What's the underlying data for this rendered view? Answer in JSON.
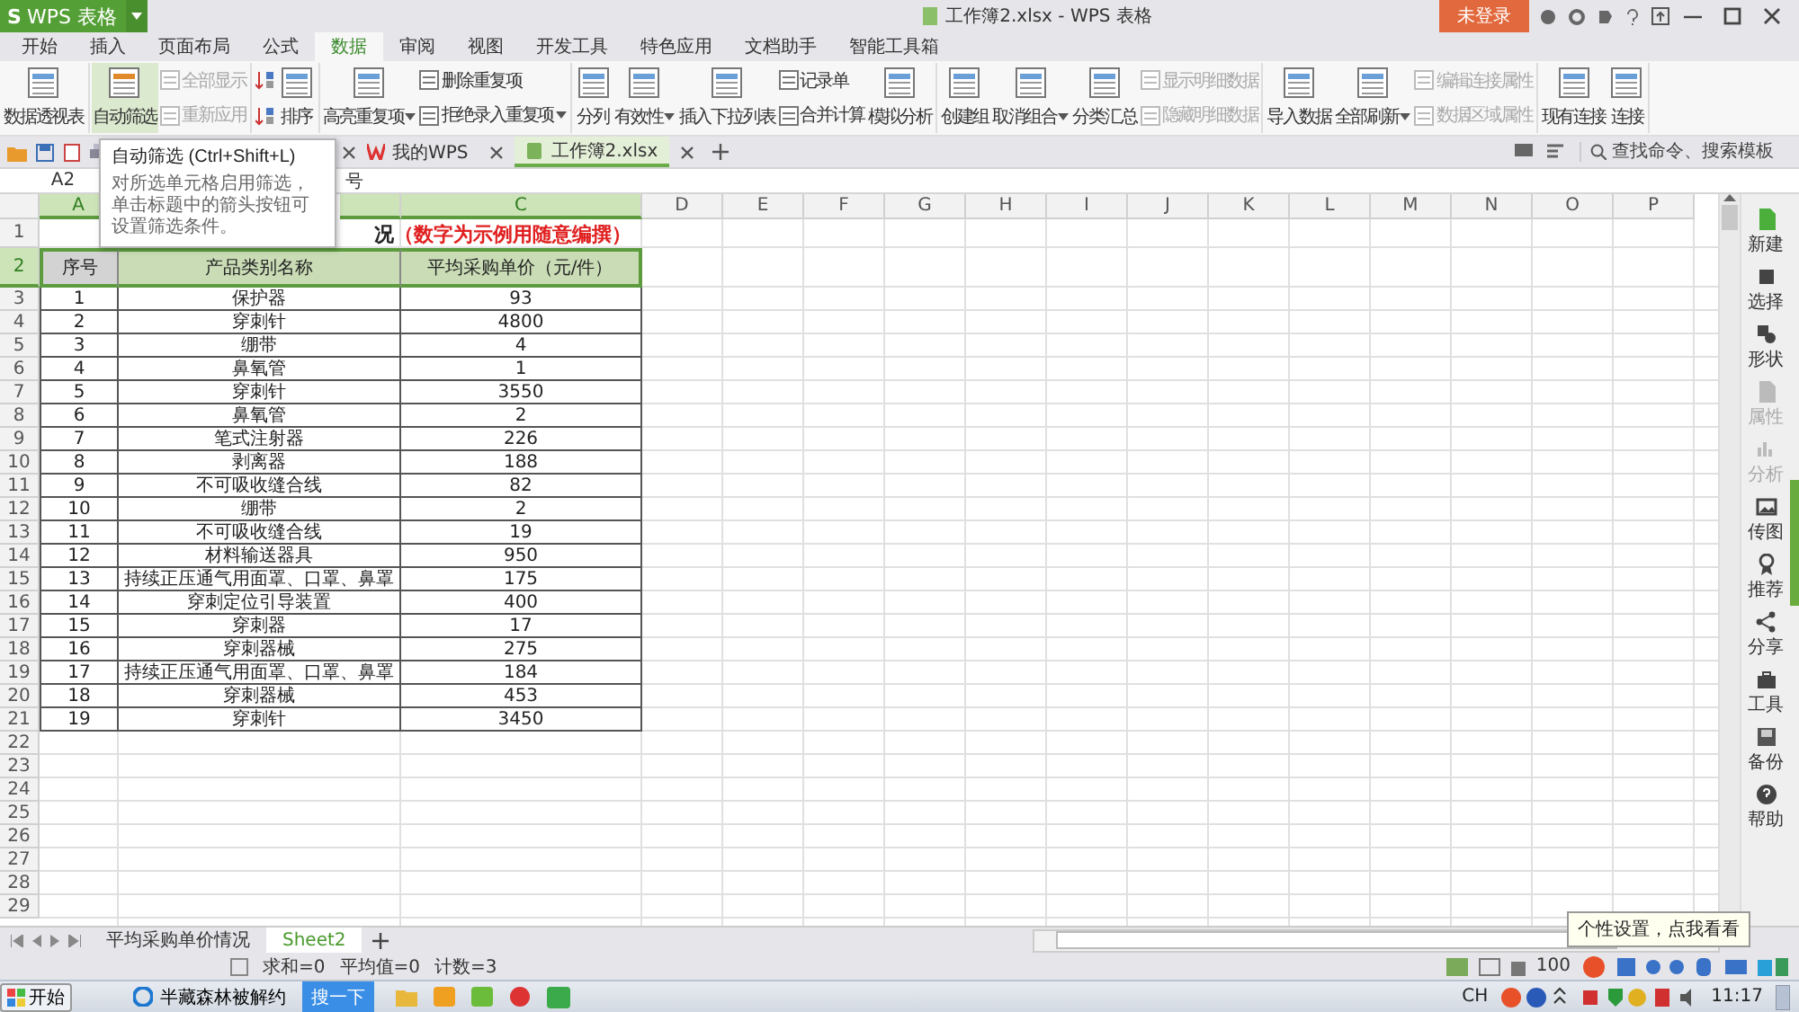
{
  "app_button": {
    "logo": "S",
    "label": "WPS 表格"
  },
  "window": {
    "title": "工作簿2.xlsx - WPS 表格"
  },
  "login_button": "未登录",
  "menu_tabs": [
    {
      "label": "开始",
      "selected": false
    },
    {
      "label": "插入",
      "selected": false
    },
    {
      "label": "页面布局",
      "selected": false
    },
    {
      "label": "公式",
      "selected": false
    },
    {
      "label": "数据",
      "selected": true
    },
    {
      "label": "审阅",
      "selected": false
    },
    {
      "label": "视图",
      "selected": false
    },
    {
      "label": "开发工具",
      "selected": false
    },
    {
      "label": "特色应用",
      "selected": false
    },
    {
      "label": "文档助手",
      "selected": false
    },
    {
      "label": "智能工具箱",
      "selected": false
    }
  ],
  "ribbon": [
    {
      "items": [
        {
          "kind": "large",
          "label": "数据透视表",
          "dropdown": false,
          "disabled": false,
          "hovered": false
        }
      ]
    },
    {
      "items": [
        {
          "kind": "large",
          "label": "自动筛选",
          "dropdown": false,
          "disabled": false,
          "hovered": true
        },
        {
          "kind": "small",
          "label": "全部显示",
          "dropdown": false,
          "disabled": true,
          "hovered": false
        },
        {
          "kind": "small",
          "label": "重新应用",
          "dropdown": false,
          "disabled": true,
          "hovered": false
        }
      ]
    },
    {
      "items": [
        {
          "kind": "icon"
        },
        {
          "kind": "icon"
        },
        {
          "kind": "large",
          "label": "排序",
          "dropdown": false,
          "disabled": false,
          "hovered": false
        }
      ]
    },
    {
      "items": [
        {
          "kind": "large",
          "label": "高亮重复项",
          "dropdown": true,
          "disabled": false,
          "hovered": false
        },
        {
          "kind": "small",
          "label": "删除重复项",
          "dropdown": false,
          "disabled": false,
          "hovered": false
        },
        {
          "kind": "small",
          "label": "拒绝录入重复项",
          "dropdown": true,
          "disabled": false,
          "hovered": false
        }
      ]
    },
    {
      "items": [
        {
          "kind": "large",
          "label": "分列",
          "dropdown": false,
          "disabled": false,
          "hovered": false
        },
        {
          "kind": "large",
          "label": "有效性",
          "dropdown": true,
          "disabled": false,
          "hovered": false
        },
        {
          "kind": "large",
          "label": "插入下拉列表",
          "dropdown": false,
          "disabled": false,
          "hovered": false
        },
        {
          "kind": "small",
          "label": "记录单",
          "dropdown": false,
          "disabled": false,
          "hovered": false
        },
        {
          "kind": "small",
          "label": "合并计算",
          "dropdown": false,
          "disabled": false,
          "hovered": false
        },
        {
          "kind": "large",
          "label": "模拟分析",
          "dropdown": false,
          "disabled": false,
          "hovered": false
        }
      ]
    },
    {
      "items": [
        {
          "kind": "large",
          "label": "创建组",
          "dropdown": false,
          "disabled": false,
          "hovered": false
        },
        {
          "kind": "large",
          "label": "取消组合",
          "dropdown": true,
          "disabled": false,
          "hovered": false
        },
        {
          "kind": "large",
          "label": "分类汇总",
          "dropdown": false,
          "disabled": false,
          "hovered": false
        },
        {
          "kind": "small",
          "label": "显示明细数据",
          "dropdown": false,
          "disabled": true,
          "hovered": false
        },
        {
          "kind": "small",
          "label": "隐藏明细数据",
          "dropdown": false,
          "disabled": true,
          "hovered": false
        }
      ]
    },
    {
      "items": [
        {
          "kind": "large",
          "label": "导入数据",
          "dropdown": false,
          "disabled": false,
          "hovered": false
        },
        {
          "kind": "large",
          "label": "全部刷新",
          "dropdown": true,
          "disabled": false,
          "hovered": false
        },
        {
          "kind": "small",
          "label": "编辑连接属性",
          "dropdown": false,
          "disabled": true,
          "hovered": false
        },
        {
          "kind": "small",
          "label": "数据区域属性",
          "dropdown": false,
          "disabled": true,
          "hovered": false
        }
      ]
    },
    {
      "items": [
        {
          "kind": "large",
          "label": "现有连接",
          "dropdown": false,
          "disabled": false,
          "hovered": false
        },
        {
          "kind": "large",
          "label": "连接",
          "dropdown": false,
          "disabled": false,
          "hovered": false
        }
      ]
    }
  ],
  "doc_tabs": [
    {
      "label": "我的WPS",
      "selected": false
    },
    {
      "label": "工作簿2.xlsx",
      "selected": true
    }
  ],
  "search": {
    "placeholder": "查找命令、搜索模板"
  },
  "formula_bar": {
    "cell": "A2",
    "content": "号"
  },
  "sheet": {
    "columns": [
      {
        "label": "A",
        "selected": true
      },
      {
        "selected": true
      },
      {
        "label": "C",
        "selected": true
      },
      {
        "label": "D",
        "selected": false
      },
      {
        "label": "E",
        "selected": false
      },
      {
        "label": "F",
        "selected": false
      },
      {
        "label": "G",
        "selected": false
      },
      {
        "label": "H",
        "selected": false
      },
      {
        "label": "I",
        "selected": false
      },
      {
        "label": "J",
        "selected": false
      },
      {
        "label": "K",
        "selected": false
      },
      {
        "label": "L",
        "selected": false
      },
      {
        "label": "M",
        "selected": false
      },
      {
        "label": "N",
        "selected": false
      },
      {
        "label": "O",
        "selected": false
      },
      {
        "label": "P",
        "selected": false
      }
    ],
    "row_numbers": [
      {
        "label": "1",
        "selected": false
      },
      {
        "label": "2",
        "selected": true
      },
      {
        "label": "3",
        "selected": false
      },
      {
        "label": "4",
        "selected": false
      },
      {
        "label": "5",
        "selected": false
      },
      {
        "label": "6",
        "selected": false
      },
      {
        "label": "7",
        "selected": false
      },
      {
        "label": "8",
        "selected": false
      },
      {
        "label": "9",
        "selected": false
      },
      {
        "label": "10",
        "selected": false
      },
      {
        "label": "11",
        "selected": false
      },
      {
        "label": "12",
        "selected": false
      },
      {
        "label": "13",
        "selected": false
      },
      {
        "label": "14",
        "selected": false
      },
      {
        "label": "15",
        "selected": false
      },
      {
        "label": "16",
        "selected": false
      },
      {
        "label": "17",
        "selected": false
      },
      {
        "label": "18",
        "selected": false
      },
      {
        "label": "19",
        "selected": false
      },
      {
        "label": "20",
        "selected": false
      },
      {
        "label": "21",
        "selected": false
      },
      {
        "label": "22",
        "selected": false
      },
      {
        "label": "23",
        "selected": false
      },
      {
        "label": "24",
        "selected": false
      },
      {
        "label": "25",
        "selected": false
      },
      {
        "label": "26",
        "selected": false
      },
      {
        "label": "27",
        "selected": false
      },
      {
        "label": "28",
        "selected": false
      },
      {
        "label": "29",
        "selected": false
      }
    ],
    "title_parts": [
      {
        "text": "况",
        "emphasis": false
      },
      {
        "text": "（数字为示例用随意编撰）",
        "emphasis": true
      }
    ],
    "header": [
      "序号",
      "产品类别名称",
      "平均采购单价（元/件）"
    ],
    "rows": [
      [
        "1",
        "保护器",
        "93"
      ],
      [
        "2",
        "穿刺针",
        "4800"
      ],
      [
        "3",
        "绷带",
        "4"
      ],
      [
        "4",
        "鼻氧管",
        "1"
      ],
      [
        "5",
        "穿刺针",
        "3550"
      ],
      [
        "6",
        "鼻氧管",
        "2"
      ],
      [
        "7",
        "笔式注射器",
        "226"
      ],
      [
        "8",
        "剥离器",
        "188"
      ],
      [
        "9",
        "不可吸收缝合线",
        "82"
      ],
      [
        "10",
        "绷带",
        "2"
      ],
      [
        "11",
        "不可吸收缝合线",
        "19"
      ],
      [
        "12",
        "材料输送器具",
        "950"
      ],
      [
        "13",
        "持续正压通气用面罩、口罩、鼻罩",
        "175"
      ],
      [
        "14",
        "穿刺定位引导装置",
        "400"
      ],
      [
        "15",
        "穿刺器",
        "17"
      ],
      [
        "16",
        "穿刺器械",
        "275"
      ],
      [
        "17",
        "持续正压通气用面罩、口罩、鼻罩",
        "184"
      ],
      [
        "18",
        "穿刺器械",
        "453"
      ],
      [
        "19",
        "穿刺针",
        "3450"
      ]
    ]
  },
  "sidebar": [
    {
      "label": "新建",
      "disabled": false
    },
    {
      "label": "选择",
      "disabled": false
    },
    {
      "label": "形状",
      "disabled": false
    },
    {
      "label": "属性",
      "disabled": true
    },
    {
      "label": "分析",
      "disabled": true
    },
    {
      "label": "传图",
      "disabled": false
    },
    {
      "label": "推荐",
      "disabled": false
    },
    {
      "label": "分享",
      "disabled": false
    },
    {
      "label": "工具",
      "disabled": false
    },
    {
      "label": "备份",
      "disabled": false
    },
    {
      "label": "帮助",
      "disabled": false
    }
  ],
  "sheet_tabs": [
    {
      "label": "平均采购单价情况",
      "selected": false
    },
    {
      "label": "Sheet2",
      "selected": true
    }
  ],
  "status_bar": {
    "stats": [
      "求和=0",
      "平均值=0",
      "计数=3"
    ],
    "zoom": "100"
  },
  "tooltip": {
    "title": "自动筛选 (Ctrl+Shift+L)",
    "text": "对所选单元格启用筛选，单击标题中的箭头按钮可设置筛选条件。"
  },
  "balloon": {
    "text": "个性设置，点我看看"
  },
  "taskbar": {
    "start": "开始",
    "windows": [
      {
        "label": "半藏森林被解约"
      }
    ],
    "search_button": "搜一下",
    "language": "CH",
    "clock": "11:17"
  }
}
